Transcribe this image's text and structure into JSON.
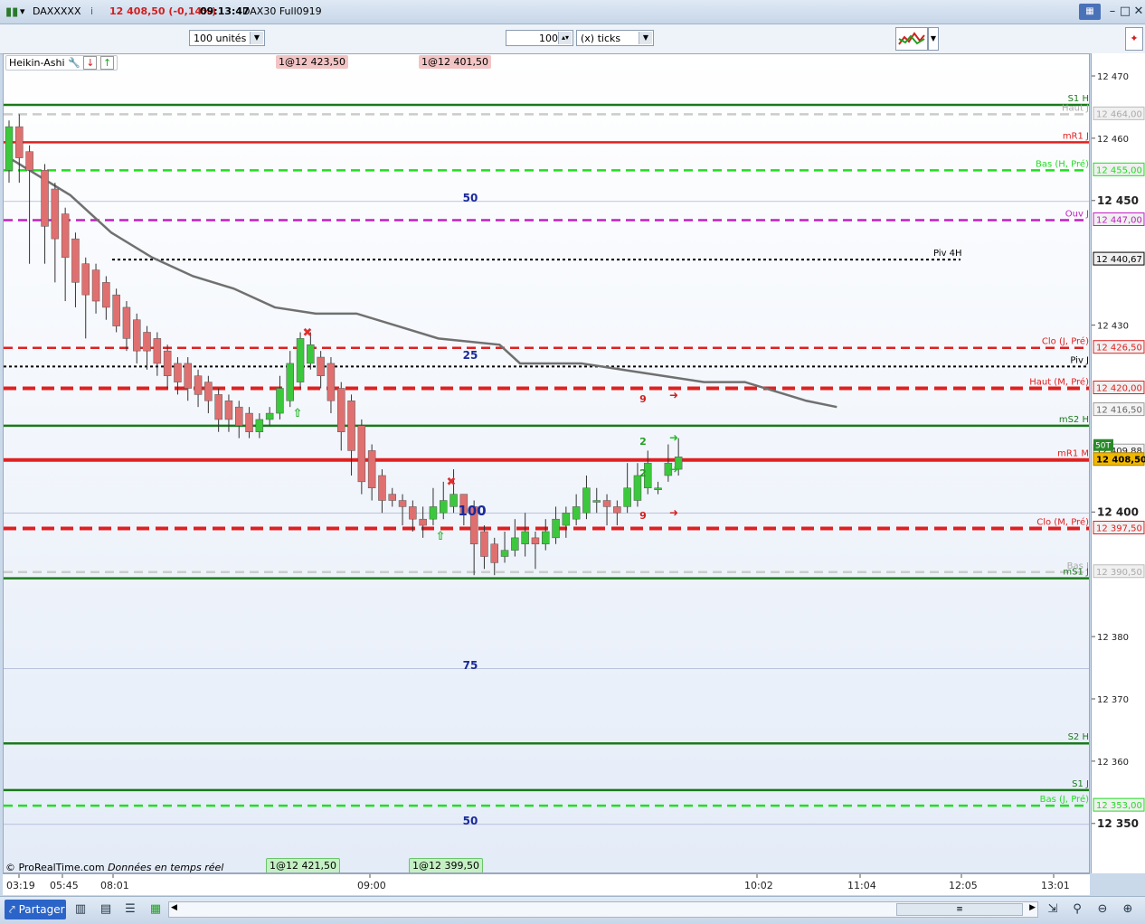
{
  "window": {
    "symbol": "DAXXXXX",
    "price_info": "12 408,50 (-0,14%)",
    "time": "09:13:47",
    "instrument": "DAX30 Full0919"
  },
  "toolbar": {
    "units_select": "100 unités",
    "ticks_value": "100",
    "ticks_select": "(x) ticks"
  },
  "chart": {
    "indicator_label": "Heikin-Ashi",
    "order_tags_top": [
      "1@12 423,50",
      "1@12 401,50"
    ],
    "order_tags_bottom": [
      "1@12 421,50",
      "1@12 399,50"
    ],
    "copyright": "© ProRealTime.com",
    "realtime_note": "Données en temps réel",
    "overlay_numbers": [
      "50",
      "25",
      "100",
      "75",
      "50"
    ],
    "markers": {
      "nine": "9",
      "two": "2"
    }
  },
  "chart_data": {
    "type": "candlestick",
    "ylim": [
      12345,
      12475
    ],
    "y_ticks": [
      "12 470",
      "12 460",
      "12 450",
      "12 430",
      "12 400",
      "12 380",
      "12 370",
      "12 360",
      "12 350"
    ],
    "x_ticks": [
      "03:19",
      "05:45",
      "08:01",
      "09:00",
      "10:02",
      "11:04",
      "12:05",
      "13:01"
    ],
    "levels": [
      {
        "name": "S1 H",
        "value": 12465.5,
        "color": "#1a7a1a",
        "style": "solid"
      },
      {
        "name": "Haut J",
        "value": 12464.0,
        "color": "#cccccc",
        "style": "dashed",
        "price_label": "12 464,00"
      },
      {
        "name": "mR1 J",
        "value": 12459.5,
        "color": "#e02020",
        "style": "solid"
      },
      {
        "name": "Bas (H, Pré)",
        "value": 12455.0,
        "color": "#22dd22",
        "style": "dashed",
        "price_label": "12 455,00"
      },
      {
        "name": "Ouv J",
        "value": 12447.0,
        "color": "#c020c0",
        "style": "dashed",
        "price_label": "12 447,00"
      },
      {
        "name": "Piv 4H",
        "value": 12440.67,
        "color": "#000000",
        "style": "dotted",
        "price_label": "12 440,67"
      },
      {
        "name": "Clo (J, Pré)",
        "value": 12426.5,
        "color": "#e02020",
        "style": "dashed",
        "price_label": "12 426,50"
      },
      {
        "name": "Piv J",
        "value": 12423.5,
        "color": "#000000",
        "style": "dotted"
      },
      {
        "name": "Haut (M, Pré)",
        "value": 12420.0,
        "color": "#e02020",
        "style": "dashed-thick",
        "price_label": "12 420,00"
      },
      {
        "name": "mS2 H",
        "value": 12414.0,
        "color": "#1a7a1a",
        "style": "solid"
      },
      {
        "name": "mR1 M",
        "value": 12408.5,
        "color": "#e02020",
        "style": "solid-thick"
      },
      {
        "name": "Clo (M, Pré)",
        "value": 12397.5,
        "color": "#e02020",
        "style": "dashed-thick",
        "price_label": "12 397,50"
      },
      {
        "name": "Bas J",
        "value": 12390.5,
        "color": "#cccccc",
        "style": "dashed",
        "price_label": "12 390,50"
      },
      {
        "name": "mS1 J",
        "value": 12389.5,
        "color": "#1a7a1a",
        "style": "solid"
      },
      {
        "name": "S2 H",
        "value": 12363.0,
        "color": "#1a7a1a",
        "style": "solid"
      },
      {
        "name": "S1 J",
        "value": 12355.5,
        "color": "#1a7a1a",
        "style": "solid"
      },
      {
        "name": "Bas (J, Pré)",
        "value": 12353.0,
        "color": "#22dd22",
        "style": "dashed",
        "price_label": "12 353,00"
      }
    ],
    "extra_price_labels": [
      "12 416,50",
      "12 409,88"
    ],
    "last_price": "12 408,50",
    "last_tag": "50T",
    "moving_average": [
      [
        0,
        12457
      ],
      [
        12,
        12451
      ],
      [
        20,
        12445
      ],
      [
        28,
        12441
      ],
      [
        36,
        12438
      ],
      [
        44,
        12436
      ],
      [
        52,
        12433
      ],
      [
        60,
        12432
      ],
      [
        68,
        12432
      ],
      [
        76,
        12430
      ],
      [
        84,
        12428
      ],
      [
        96,
        12427
      ],
      [
        100,
        12424
      ],
      [
        112,
        12424
      ],
      [
        120,
        12423
      ],
      [
        128,
        12422
      ],
      [
        136,
        12421
      ],
      [
        144,
        12421
      ],
      [
        156,
        12418
      ],
      [
        162,
        12417
      ]
    ],
    "candles": [
      [
        0,
        12455,
        12462,
        12463,
        12453
      ],
      [
        2,
        12462,
        12457,
        12464,
        12453
      ],
      [
        4,
        12458,
        12455,
        12459,
        12440
      ],
      [
        7,
        12455,
        12446,
        12456,
        12440
      ],
      [
        9,
        12452,
        12444,
        12453,
        12437
      ],
      [
        11,
        12448,
        12441,
        12449,
        12434
      ],
      [
        13,
        12444,
        12437,
        12445,
        12433
      ],
      [
        15,
        12440,
        12435,
        12441,
        12428
      ],
      [
        17,
        12439,
        12434,
        12440,
        12432
      ],
      [
        19,
        12437,
        12433,
        12438,
        12431
      ],
      [
        21,
        12435,
        12430,
        12436,
        12429
      ],
      [
        23,
        12433,
        12428,
        12434,
        12426
      ],
      [
        25,
        12431,
        12426,
        12432,
        12424
      ],
      [
        27,
        12429,
        12426,
        12430,
        12423
      ],
      [
        29,
        12428,
        12424,
        12429,
        12422
      ],
      [
        31,
        12426,
        12422,
        12427,
        12420
      ],
      [
        33,
        12424,
        12421,
        12425,
        12419
      ],
      [
        35,
        12424,
        12420,
        12425,
        12418
      ],
      [
        37,
        12422,
        12419,
        12423,
        12417
      ],
      [
        39,
        12421,
        12418,
        12422,
        12416
      ],
      [
        41,
        12419,
        12415,
        12420,
        12413
      ],
      [
        43,
        12418,
        12415,
        12419,
        12413
      ],
      [
        45,
        12417,
        12414,
        12418,
        12412
      ],
      [
        47,
        12416,
        12413,
        12417,
        12412
      ],
      [
        49,
        12413,
        12415,
        12416,
        12412
      ],
      [
        51,
        12415,
        12416,
        12417,
        12414
      ],
      [
        53,
        12416,
        12420,
        12422,
        12415
      ],
      [
        55,
        12418,
        12424,
        12426,
        12417
      ],
      [
        57,
        12421,
        12428,
        12429,
        12420
      ],
      [
        59,
        12424,
        12427,
        12429,
        12423
      ],
      [
        61,
        12425,
        12422,
        12426,
        12420
      ],
      [
        63,
        12424,
        12418,
        12425,
        12416
      ],
      [
        65,
        12420,
        12413,
        12421,
        12410
      ],
      [
        67,
        12418,
        12410,
        12419,
        12406
      ],
      [
        69,
        12414,
        12405,
        12415,
        12403
      ],
      [
        71,
        12410,
        12404,
        12411,
        12402
      ],
      [
        73,
        12406,
        12402,
        12407,
        12400
      ],
      [
        75,
        12403,
        12402,
        12404,
        12401
      ],
      [
        77,
        12402,
        12401,
        12403,
        12398
      ],
      [
        79,
        12401,
        12399,
        12402,
        12397
      ],
      [
        81,
        12399,
        12398,
        12401,
        12396
      ],
      [
        83,
        12399,
        12401,
        12404,
        12398
      ],
      [
        85,
        12400,
        12402,
        12405,
        12399
      ],
      [
        87,
        12401,
        12403,
        12407,
        12400
      ],
      [
        89,
        12403,
        12400,
        12403,
        12398
      ],
      [
        91,
        12401,
        12395,
        12402,
        12390
      ],
      [
        93,
        12397,
        12393,
        12398,
        12391
      ],
      [
        95,
        12395,
        12392,
        12396,
        12390
      ],
      [
        97,
        12393,
        12394,
        12397,
        12392
      ],
      [
        99,
        12394,
        12396,
        12399,
        12393
      ],
      [
        101,
        12395,
        12397,
        12400,
        12393
      ],
      [
        103,
        12396,
        12395,
        12397,
        12391
      ],
      [
        105,
        12395,
        12397,
        12399,
        12394
      ],
      [
        107,
        12396,
        12399,
        12401,
        12395
      ],
      [
        109,
        12398,
        12400,
        12401,
        12396
      ],
      [
        111,
        12399,
        12401,
        12403,
        12398
      ],
      [
        113,
        12400,
        12404,
        12406,
        12399
      ],
      [
        115,
        12402,
        12402,
        12404,
        12400
      ],
      [
        117,
        12402,
        12401,
        12403,
        12398
      ],
      [
        119,
        12401,
        12400,
        12402,
        12398
      ],
      [
        121,
        12401,
        12404,
        12408,
        12400
      ],
      [
        123,
        12402,
        12406,
        12408,
        12401
      ],
      [
        125,
        12404,
        12408,
        12410,
        12403
      ],
      [
        127,
        12404,
        12404,
        12405,
        12403
      ],
      [
        129,
        12406,
        12408,
        12411,
        12405
      ],
      [
        131,
        12407,
        12409,
        12412,
        12406
      ]
    ]
  },
  "statusbar": {
    "share_button": "Partager"
  },
  "colors": {
    "up": "#3cc83c",
    "down": "#e07070",
    "ma": "#707070",
    "overlay_blue": "#1a2a9a"
  }
}
